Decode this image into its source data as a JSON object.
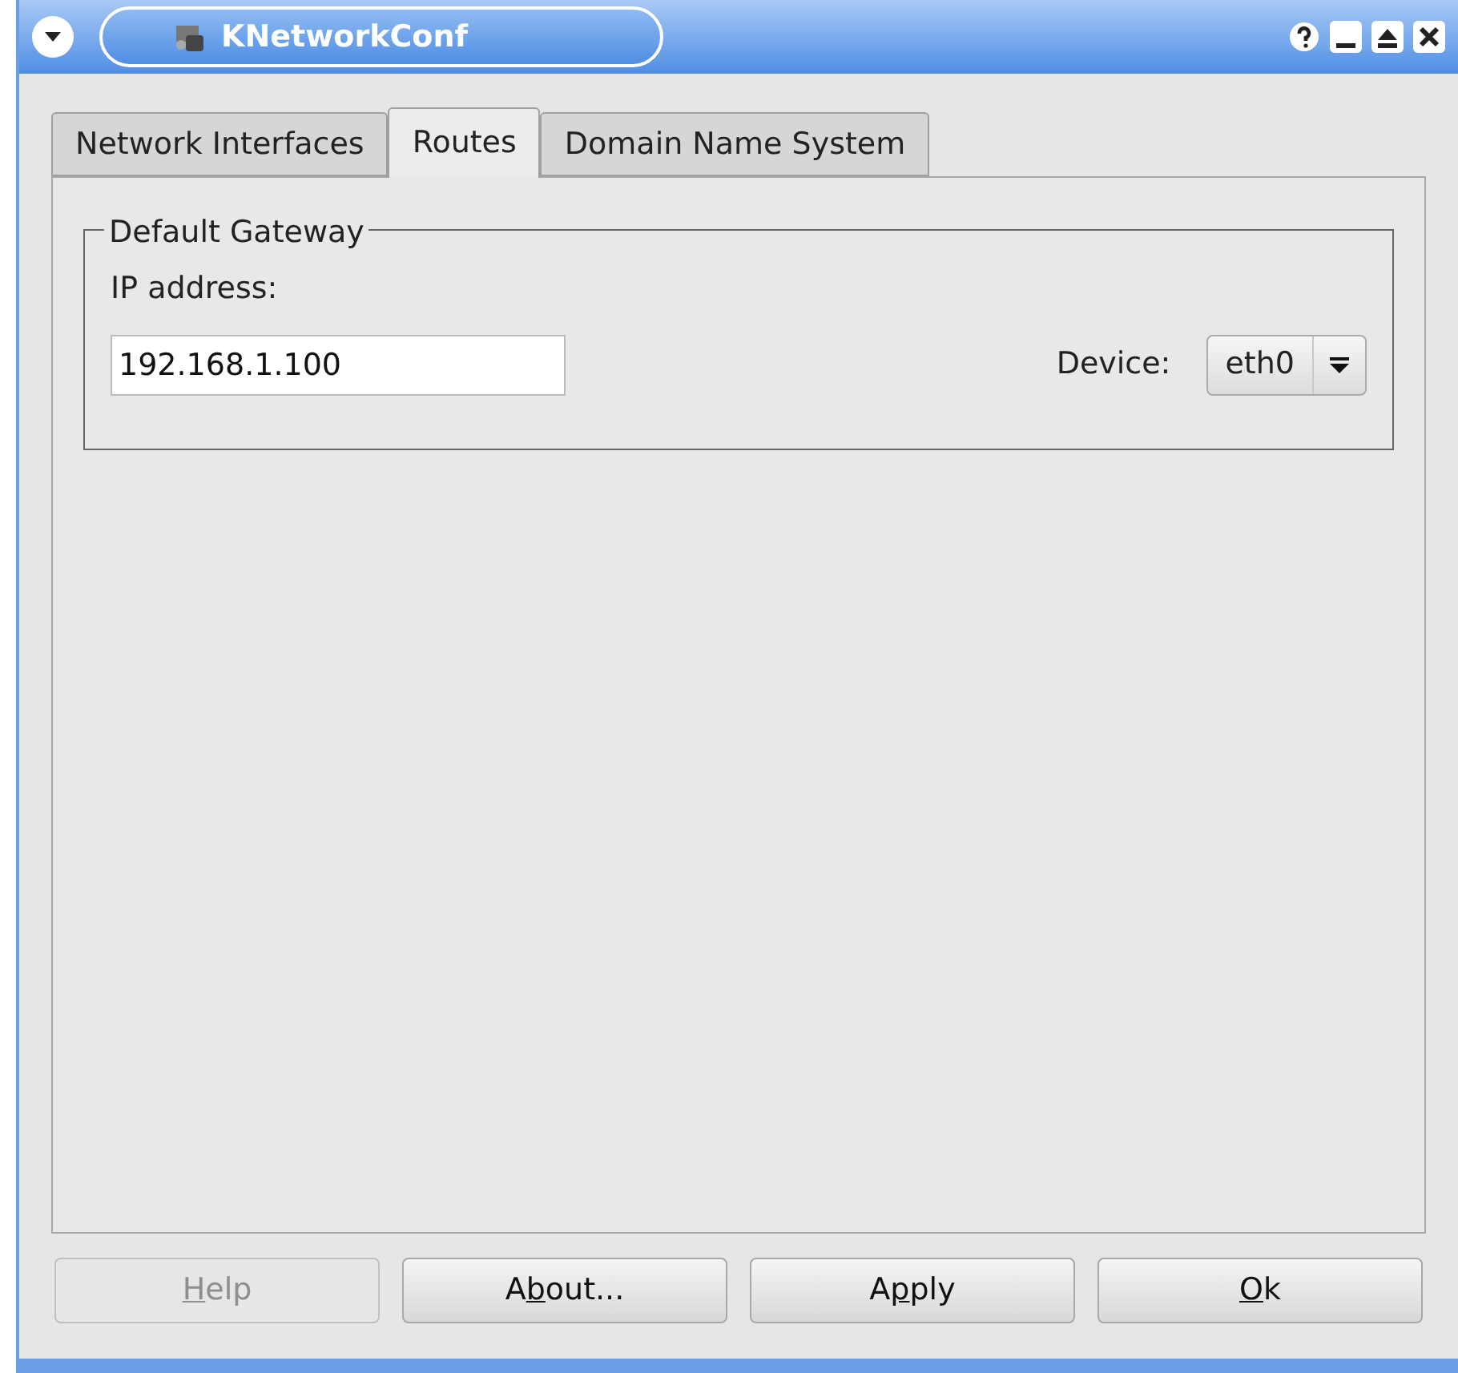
{
  "window": {
    "title": "KNetworkConf"
  },
  "tabs": [
    {
      "label": "Network Interfaces",
      "selected": false
    },
    {
      "label": "Routes",
      "selected": true
    },
    {
      "label": "Domain Name System",
      "selected": false
    }
  ],
  "gateway": {
    "title": "Default Gateway",
    "ip_label": "IP address:",
    "ip_value": "192.168.1.100",
    "device_label": "Device:",
    "device_value": "eth0"
  },
  "buttons": [
    {
      "key": "H",
      "after": "elp",
      "disabled": true
    },
    {
      "before": "A",
      "key": "b",
      "after": "out...",
      "disabled": false
    },
    {
      "before": "A",
      "key": "p",
      "after": "ply",
      "disabled": false
    },
    {
      "key": "O",
      "after": "k",
      "disabled": false
    }
  ]
}
